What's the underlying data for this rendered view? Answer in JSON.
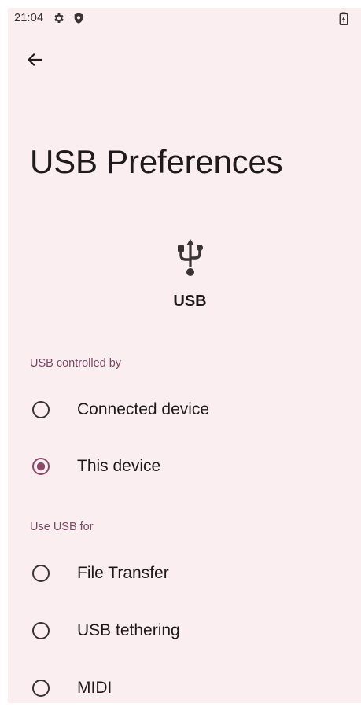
{
  "status_bar": {
    "time": "21:04",
    "icons": [
      "gear-icon",
      "shield-icon",
      "battery-charging-icon"
    ]
  },
  "toolbar": {
    "back_icon": "arrow-left-icon"
  },
  "page": {
    "title": "USB Preferences",
    "illustration_icon": "usb-icon",
    "illustration_caption": "USB"
  },
  "sections": [
    {
      "header": "USB controlled by",
      "options": [
        {
          "label": "Connected device",
          "selected": false
        },
        {
          "label": "This device",
          "selected": true
        }
      ]
    },
    {
      "header": "Use USB for",
      "options": [
        {
          "label": "File Transfer",
          "selected": false
        },
        {
          "label": "USB tethering",
          "selected": false
        },
        {
          "label": "MIDI",
          "selected": false
        }
      ]
    }
  ],
  "colors": {
    "background": "#fbeef1",
    "accent": "#8a4a6b",
    "section_header": "#7c4a62",
    "text": "#1f1a1c"
  }
}
